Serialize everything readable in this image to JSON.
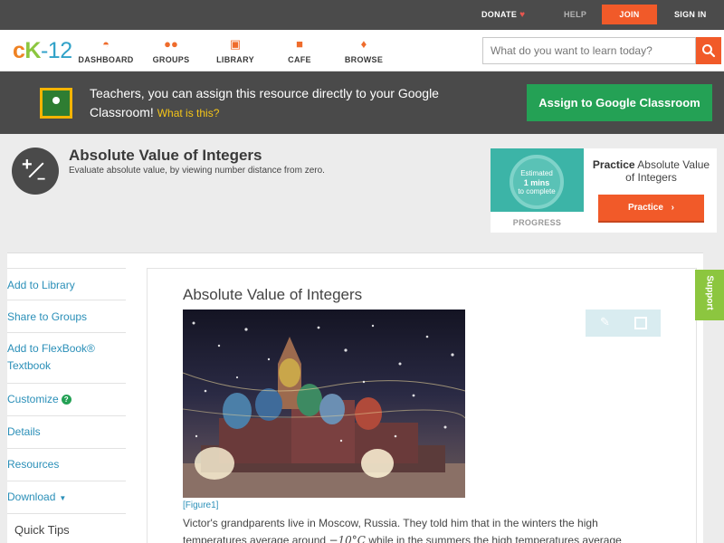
{
  "topbar": {
    "donate": "DONATE",
    "help": "HELP",
    "join": "JOIN",
    "signin": "SIGN IN"
  },
  "nav": {
    "logo": {
      "part1": "c",
      "part2": "K",
      "part3": "-12"
    },
    "items": [
      {
        "label": "DASHBOARD",
        "icon": "dashboard-icon"
      },
      {
        "label": "GROUPS",
        "icon": "groups-icon"
      },
      {
        "label": "LIBRARY",
        "icon": "library-icon"
      },
      {
        "label": "CAFE",
        "icon": "cafe-icon"
      },
      {
        "label": "BROWSE",
        "icon": "browse-icon"
      }
    ],
    "search_placeholder": "What do you want to learn today?"
  },
  "banner": {
    "text": "Teachers, you can assign this resource directly to your Google Classroom!",
    "link": "What is this?",
    "button": "Assign to Google Classroom"
  },
  "header": {
    "title": "Absolute Value of Integers",
    "subtitle": "Evaluate absolute value, by viewing number distance from zero."
  },
  "practice": {
    "estimate_line1": "Estimated",
    "estimate_line2": "1 mins",
    "estimate_line3": "to complete",
    "progress_label": "PROGRESS",
    "title_bold": "Practice",
    "title_rest": "Absolute Value of Integers",
    "button": "Practice"
  },
  "sidebar": {
    "items": [
      {
        "label": "Add to Library"
      },
      {
        "label": "Share to Groups"
      },
      {
        "label": "Add to FlexBook® Textbook"
      },
      {
        "label": "Customize"
      },
      {
        "label": "Details"
      },
      {
        "label": "Resources"
      },
      {
        "label": "Download"
      }
    ],
    "quick_tips": "Quick Tips"
  },
  "content": {
    "title": "Absolute Value of Integers",
    "figure_caption": "[Figure1]",
    "para_line1": "Victor's grandparents live in Moscow, Russia. They told him that in the winters the high",
    "para_line2_a": "temperatures average around",
    "para_math1": "−10°C",
    "para_line2_b": "while in the summers the high temperatures average",
    "support": "Support"
  },
  "colors": {
    "accent_orange": "#f15a29",
    "green": "#24a155",
    "link_blue": "#2a8fb8",
    "dark_bar": "#4b4b4b"
  }
}
